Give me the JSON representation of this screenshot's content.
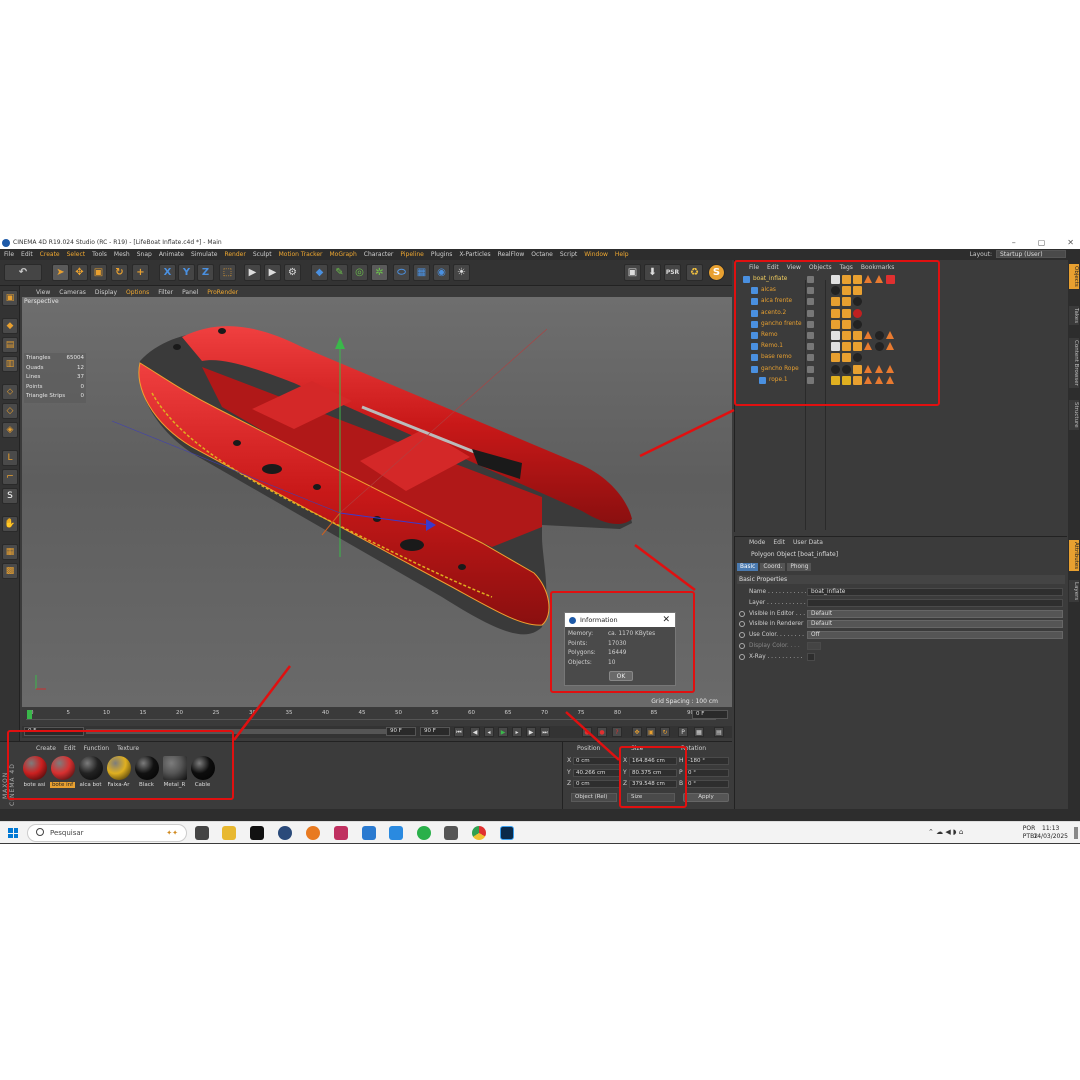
{
  "window": {
    "title": "CINEMA 4D R19.024 Studio (RC - R19) - [LifeBoat Inflate.c4d *] - Main"
  },
  "menu": [
    "File",
    "Edit",
    "Create",
    "Select",
    "Tools",
    "Mesh",
    "Snap",
    "Animate",
    "Simulate",
    "Render",
    "Sculpt",
    "Motion Tracker",
    "MoGraph",
    "Character",
    "Pipeline",
    "Plugins",
    "X-Particles",
    "RealFlow",
    "Octane",
    "Script",
    "Window",
    "Help"
  ],
  "layout": {
    "label": "Layout:",
    "value": "Startup (User)"
  },
  "viewport": {
    "menu": [
      "View",
      "Cameras",
      "Display",
      "Options",
      "Filter",
      "Panel",
      "ProRender"
    ],
    "label": "Perspective",
    "stats": [
      {
        "k": "Triangles",
        "v": "65004"
      },
      {
        "k": "Quads",
        "v": "12"
      },
      {
        "k": "Lines",
        "v": "37"
      },
      {
        "k": "Points",
        "v": "0"
      },
      {
        "k": "Triangle Strips",
        "v": "0"
      }
    ],
    "grid_spacing": "Grid Spacing : 100 cm"
  },
  "info_dialog": {
    "title": "Information",
    "rows": [
      {
        "k": "Memory:",
        "v": "ca. 1170 KBytes"
      },
      {
        "k": "Points:",
        "v": "17030"
      },
      {
        "k": "Polygons:",
        "v": "16449"
      },
      {
        "k": "Objects:",
        "v": "10"
      }
    ],
    "ok": "OK"
  },
  "timeline": {
    "ticks": [
      "0",
      "5",
      "10",
      "15",
      "20",
      "25",
      "30",
      "35",
      "40",
      "45",
      "50",
      "55",
      "60",
      "65",
      "70",
      "75",
      "80",
      "85",
      "90"
    ],
    "end_frame_label": "0 F",
    "current": "0 F",
    "start_field": "0 F",
    "end_field": "90 F",
    "end_field2": "90 F"
  },
  "materials": {
    "menu": [
      "Create",
      "Edit",
      "Function",
      "Texture"
    ],
    "items": [
      {
        "label": "bote asi",
        "color": "#cc2020",
        "selected": false
      },
      {
        "label": "bote inf",
        "color": "#d83030",
        "selected": true
      },
      {
        "label": "alca bot",
        "color": "#222222",
        "selected": false
      },
      {
        "label": "Faixa-Ar",
        "color": "#e0b020",
        "selected": false
      },
      {
        "label": "Black",
        "color": "#111111",
        "selected": false
      },
      {
        "label": "Metal_R",
        "color": "#555555",
        "selected": false
      },
      {
        "label": "Cable",
        "color": "#0d0d0d",
        "selected": false
      }
    ],
    "brand": "MAXON CINEMA 4D"
  },
  "coordinates": {
    "headers": [
      "Position",
      "Size",
      "Rotation"
    ],
    "rows": [
      {
        "axis": "X",
        "pos": "0 cm",
        "size": "164.846 cm",
        "rlabel": "H",
        "rot": "-180 °"
      },
      {
        "axis": "Y",
        "pos": "40.266 cm",
        "size": "80.375 cm",
        "rlabel": "P",
        "rot": "0 °"
      },
      {
        "axis": "Z",
        "pos": "0 cm",
        "size": "379.548 cm",
        "rlabel": "B",
        "rot": "0 °"
      }
    ],
    "mode": "Object (Rel)",
    "size_mode": "Size",
    "apply": "Apply"
  },
  "object_manager": {
    "menu": [
      "File",
      "Edit",
      "View",
      "Objects",
      "Tags",
      "Bookmarks"
    ],
    "objects": [
      {
        "name": "boat_inflate",
        "level": 0
      },
      {
        "name": "alcas",
        "level": 1
      },
      {
        "name": "alca frente",
        "level": 1
      },
      {
        "name": "acento.2",
        "level": 1
      },
      {
        "name": "gancho frente",
        "level": 1
      },
      {
        "name": "Remo",
        "level": 1
      },
      {
        "name": "Remo.1",
        "level": 1
      },
      {
        "name": "base remo",
        "level": 1
      },
      {
        "name": "gancho Rope",
        "level": 1
      },
      {
        "name": "rope.1",
        "level": 2
      }
    ]
  },
  "attribute_manager": {
    "menu": [
      "Mode",
      "Edit",
      "User Data"
    ],
    "object_title": "Polygon Object [boat_inflate]",
    "tabs": [
      "Basic",
      "Coord.",
      "Phong"
    ],
    "section": "Basic Properties",
    "rows": [
      {
        "label": "Name . . . . . . . . . . . .",
        "value": "boat_inflate",
        "type": "text"
      },
      {
        "label": "Layer . . . . . . . . . . . .",
        "value": "",
        "type": "text"
      },
      {
        "label": "Visible in Editor . . .",
        "value": "Default",
        "type": "dd"
      },
      {
        "label": "Visible in Renderer",
        "value": "Default",
        "type": "dd"
      },
      {
        "label": "Use Color. . . . . . . .",
        "value": "Off",
        "type": "dd"
      },
      {
        "label": "Display Color. . . .",
        "value": "",
        "type": "dim"
      },
      {
        "label": "X-Ray . . . . . . . . . .",
        "value": "",
        "type": "check"
      }
    ]
  },
  "right_tabs": [
    "Objects",
    "Takes",
    "Content Browser",
    "Structure",
    "Attributes",
    "Layers"
  ],
  "taskbar": {
    "search_placeholder": "Pesquisar",
    "lang1": "POR",
    "lang2": "PTB2",
    "time": "11:13",
    "date": "14/03/2025"
  }
}
